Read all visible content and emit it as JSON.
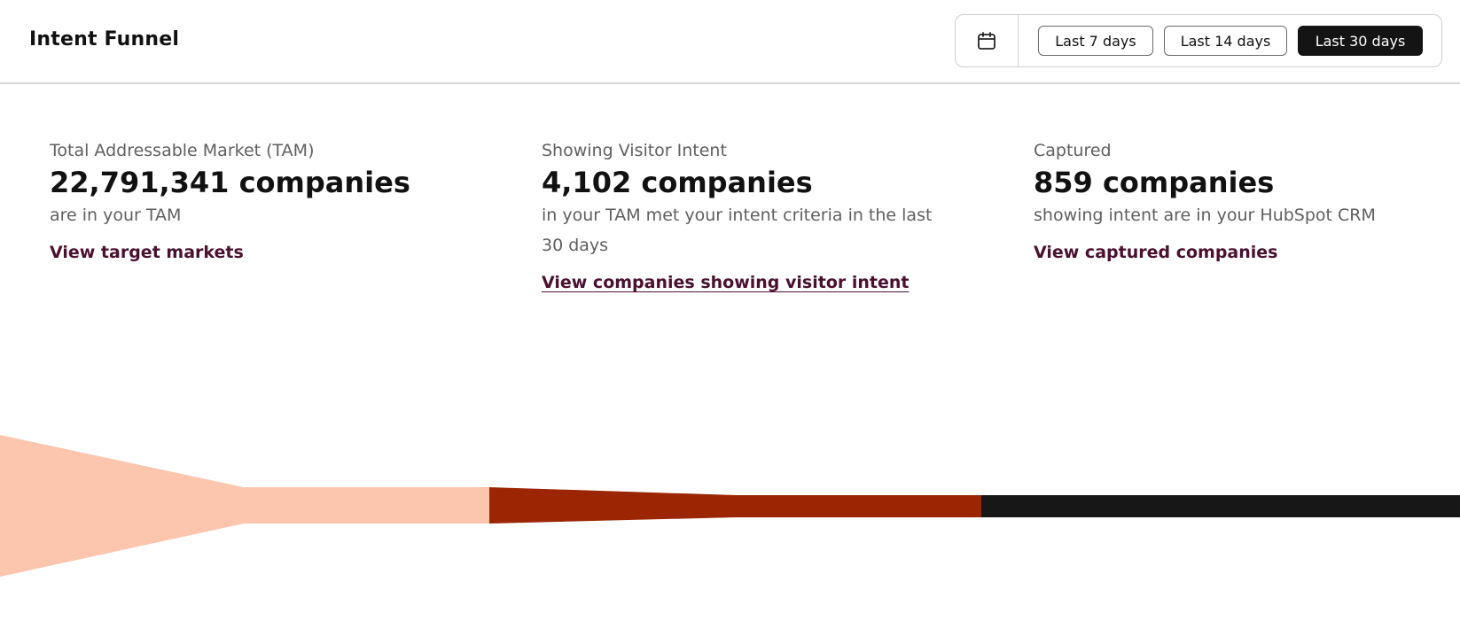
{
  "header": {
    "title": "Intent Funnel",
    "calendar_icon": "calendar-icon",
    "ranges": [
      {
        "label": "Last 7 days",
        "active": false
      },
      {
        "label": "Last 14 days",
        "active": false
      },
      {
        "label": "Last 30 days",
        "active": true
      }
    ]
  },
  "metrics": [
    {
      "label": "Total Addressable Market (TAM)",
      "value": "22,791,341 companies",
      "description": "are in your TAM",
      "link": "View target markets"
    },
    {
      "label": "Showing Visitor Intent",
      "value": "4,102 companies",
      "description": "in your TAM met your intent criteria in the last 30 days",
      "link": "View companies showing visitor intent"
    },
    {
      "label": "Captured",
      "value": "859 companies",
      "description": "showing intent are in your HubSpot CRM",
      "link": "View captured companies"
    }
  ],
  "funnel_colors": {
    "tam": "#fcc5ae",
    "intent": "#9c2503",
    "captured": "#171717"
  }
}
